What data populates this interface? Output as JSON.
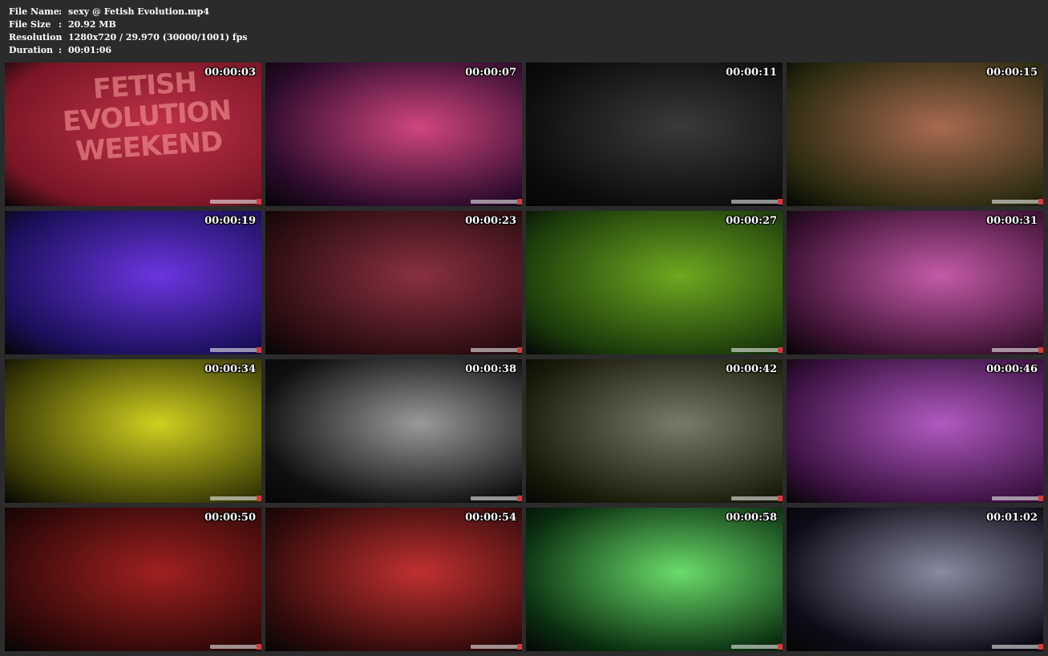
{
  "header": {
    "rows": [
      {
        "label": "File Name",
        "sep": ":",
        "value": "sexy @ Fetish Evolution.mp4"
      },
      {
        "label": "File Size",
        "sep": ":",
        "value": "20.92 MB"
      },
      {
        "label": "Resolution",
        "sep": ":",
        "value": "1280x720 / 29.970 (30000/1001) fps"
      },
      {
        "label": "Duration",
        "sep": ":",
        "value": "00:01:06"
      }
    ]
  },
  "thumbnails": [
    {
      "time": "00:00:03",
      "overlay": [
        "FETISH",
        "EVOLUTION",
        "WEEKEND"
      ],
      "colors": [
        "#7a1525",
        "#c0324a"
      ]
    },
    {
      "time": "00:00:07",
      "colors": [
        "#2a0a2a",
        "#d0457e"
      ]
    },
    {
      "time": "00:00:11",
      "colors": [
        "#0c0c0c",
        "#3a3a3a"
      ]
    },
    {
      "time": "00:00:15",
      "colors": [
        "#2a2a10",
        "#a86a50"
      ]
    },
    {
      "time": "00:00:19",
      "colors": [
        "#1a0f5a",
        "#6b35e0"
      ]
    },
    {
      "time": "00:00:23",
      "colors": [
        "#2a0c10",
        "#8a3040"
      ]
    },
    {
      "time": "00:00:27",
      "colors": [
        "#1b3a0a",
        "#6fa820"
      ]
    },
    {
      "time": "00:00:31",
      "colors": [
        "#3a1030",
        "#c45aa8"
      ]
    },
    {
      "time": "00:00:34",
      "colors": [
        "#3a3a05",
        "#d0d020"
      ]
    },
    {
      "time": "00:00:38",
      "colors": [
        "#101010",
        "#9a9a9a"
      ]
    },
    {
      "time": "00:00:42",
      "colors": [
        "#1c1c0a",
        "#7a7a68"
      ]
    },
    {
      "time": "00:00:46",
      "colors": [
        "#3a1040",
        "#b05ac0"
      ]
    },
    {
      "time": "00:00:50",
      "colors": [
        "#300808",
        "#a02020"
      ]
    },
    {
      "time": "00:00:54",
      "colors": [
        "#300a0a",
        "#c03030"
      ]
    },
    {
      "time": "00:00:58",
      "colors": [
        "#0a3010",
        "#6adc6a"
      ]
    },
    {
      "time": "00:01:02",
      "colors": [
        "#0c0c18",
        "#8a8aa0"
      ]
    }
  ]
}
